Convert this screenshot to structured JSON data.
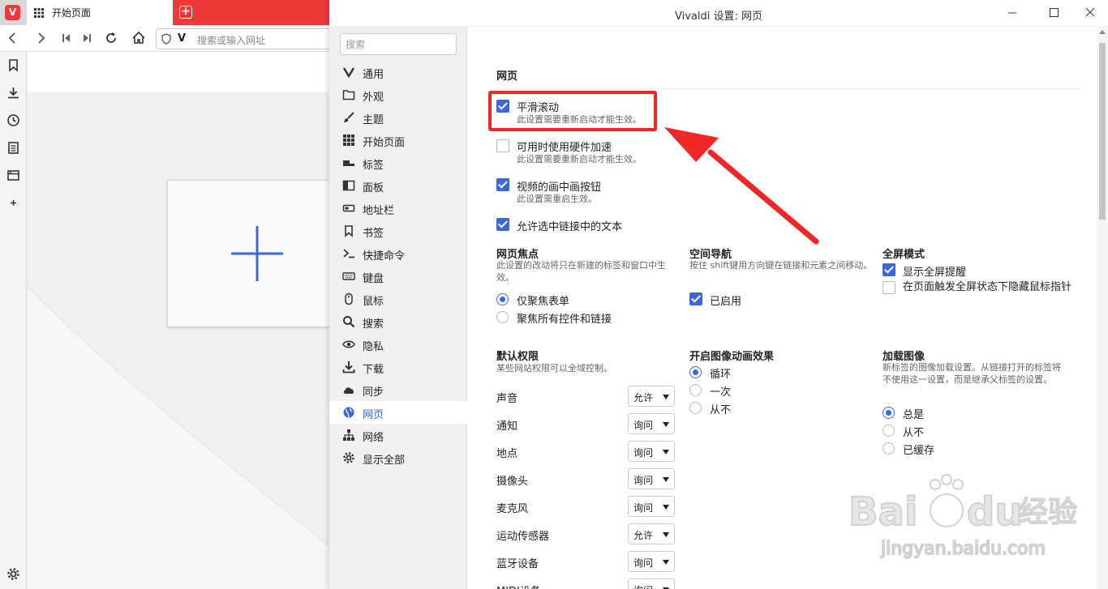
{
  "browser": {
    "tab_title": "开始页面",
    "address_placeholder": "搜索或输入网址"
  },
  "settings_window": {
    "title": "Vivaldi 设置: 网页",
    "search_placeholder": "搜索",
    "nav": [
      {
        "label": "通用",
        "icon": "vivaldi-icon"
      },
      {
        "label": "外观",
        "icon": "folder-icon"
      },
      {
        "label": "主题",
        "icon": "brush-icon"
      },
      {
        "label": "开始页面",
        "icon": "grid-icon"
      },
      {
        "label": "标签",
        "icon": "tabs-icon"
      },
      {
        "label": "面板",
        "icon": "panel-icon"
      },
      {
        "label": "地址栏",
        "icon": "address-bar-icon"
      },
      {
        "label": "书签",
        "icon": "bookmark-icon"
      },
      {
        "label": "快捷命令",
        "icon": "command-icon"
      },
      {
        "label": "键盘",
        "icon": "keyboard-icon"
      },
      {
        "label": "鼠标",
        "icon": "mouse-icon"
      },
      {
        "label": "搜索",
        "icon": "search-icon"
      },
      {
        "label": "隐私",
        "icon": "eye-icon"
      },
      {
        "label": "下载",
        "icon": "download-icon"
      },
      {
        "label": "同步",
        "icon": "cloud-icon"
      },
      {
        "label": "网页",
        "icon": "globe-icon",
        "active": true
      },
      {
        "label": "网络",
        "icon": "network-icon"
      },
      {
        "label": "显示全部",
        "icon": "gear-icon"
      }
    ]
  },
  "page": {
    "section_title": "网页",
    "options": [
      {
        "label": "平滑滚动",
        "note": "此设置需要重新启动才能生效。",
        "checked": true
      },
      {
        "label": "可用时使用硬件加速",
        "note": "此设置需要重新启动才能生效。",
        "checked": false
      },
      {
        "label": "视频的画中画按钮",
        "note": "此设置需重启生效。",
        "checked": true
      },
      {
        "label": "允许选中链接中的文本",
        "note": "",
        "checked": true
      }
    ],
    "focus": {
      "title": "网页焦点",
      "desc": "此设置的改动将只在新建的标签和窗口中生效。",
      "radios": [
        {
          "label": "仅聚焦表单",
          "selected": true
        },
        {
          "label": "聚焦所有控件和链接",
          "selected": false
        }
      ]
    },
    "spatial": {
      "title": "空间导航",
      "desc": "按住 shift键用方向键在链接和元素之间移动。",
      "checkbox": {
        "label": "已启用",
        "checked": true
      }
    },
    "fullscreen": {
      "title": "全屏模式",
      "checkboxes": [
        {
          "label": "显示全屏提醒",
          "checked": true
        },
        {
          "label": "在页面触发全屏状态下隐藏鼠标指针",
          "checked": false
        }
      ]
    },
    "permissions": {
      "title": "默认权限",
      "desc": "某些网站权限可以全域控制。",
      "rows": [
        {
          "label": "声音",
          "value": "允许"
        },
        {
          "label": "通知",
          "value": "询问"
        },
        {
          "label": "地点",
          "value": "询问"
        },
        {
          "label": "摄像头",
          "value": "询问"
        },
        {
          "label": "麦克风",
          "value": "询问"
        },
        {
          "label": "运动传感器",
          "value": "允许"
        },
        {
          "label": "蓝牙设备",
          "value": "询问"
        },
        {
          "label": "MIDI设备",
          "value": "询问"
        }
      ]
    },
    "animation": {
      "title": "开启图像动画效果",
      "radios": [
        {
          "label": "循环",
          "selected": true
        },
        {
          "label": "一次",
          "selected": false
        },
        {
          "label": "从不",
          "selected": false
        }
      ]
    },
    "images": {
      "title": "加载图像",
      "desc": "新标签的图像加载设置。从链接打开的标签将不使用这一设置，而是继承父标签的设置。",
      "radios": [
        {
          "label": "总是",
          "selected": true
        },
        {
          "label": "从不",
          "selected": false
        },
        {
          "label": "已缓存",
          "selected": false
        }
      ]
    }
  },
  "watermark": {
    "brand": "Baidu经验",
    "url": "jingyan.baidu.com"
  },
  "colors": {
    "accent": "#3d67d9",
    "highlight": "#f02727",
    "vivaldi_red": "#ef3939"
  }
}
